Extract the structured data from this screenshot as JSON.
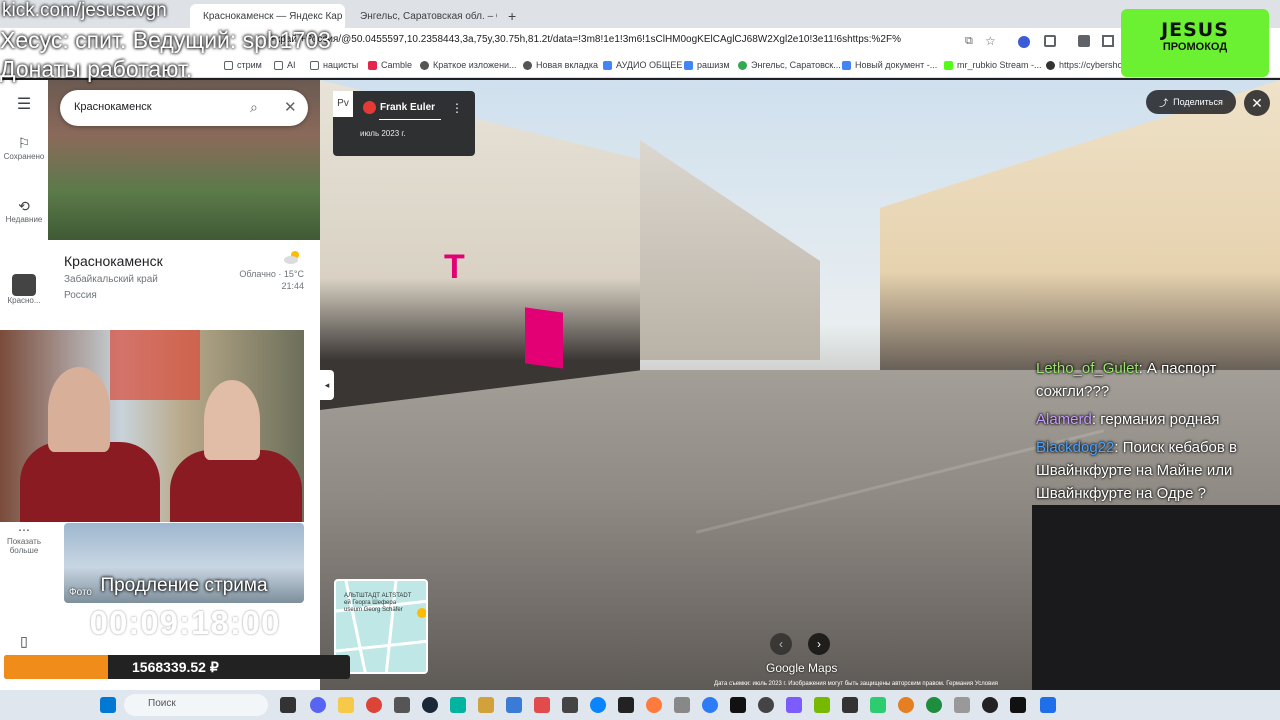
{
  "overlay": {
    "kick": "kick.com/jesusavgn",
    "host": "Хесус: спит. Ведущий: spb1703",
    "donations": "Донаты работают.",
    "promo_title": "JESUS",
    "promo_subtitle": "ПРОМОКОД",
    "extend_stream": "Продление стрима",
    "timer": "00:09:18:00",
    "donation_total": "1568339.52 ₽",
    "donation_progress": 0.3
  },
  "browser": {
    "tabs": [
      {
        "title": "Краснокаменск — Яндекс Кар",
        "color": "#ff3333"
      },
      {
        "title": "Энгельс, Саратовская обл. – G",
        "color": "#34a853"
      }
    ],
    "url": "+край,+Россия/@50.0455597,10.2358443,3a,75y,30.75h,81.2t/data=!3m8!1e1!3m6!1sClHM0ogKElCAglCJ68W2Xgl2e10!3e11!6shttps:%2F%",
    "bookmarks": [
      "стрим",
      "AI",
      "нацисты",
      "Camble",
      "Краткое изложени...",
      "Новая вкладка",
      "АУДИО ОБЩЕЕ",
      "рашизм",
      "Энгельс, Саратовск...",
      "Новый документ -...",
      "mr_rubkio Stream -...",
      "https://cybersho"
    ]
  },
  "maps": {
    "search_value": "Краснокаменск",
    "rail": {
      "saved": "Сохранено",
      "recent": "Недавние",
      "recent_place": "Красно...",
      "show_more": "Показать больше"
    },
    "place": {
      "name": "Краснокаменск",
      "region": "Забайкальский край",
      "country": "Россия",
      "weather": "Облачно · 15°C",
      "time": "21:44"
    },
    "photo_tag": "Фото"
  },
  "streetview": {
    "rv_label": "Рv",
    "author": "Frank Euler",
    "date": "июль 2023 г.",
    "share": "Поделиться",
    "minimap_label": "АЛЬТШТАДТ ALTSTADT\nей Георга Шефера\nuseum Georg Schäfer",
    "brand": "Google Maps",
    "legal": "Дата съемки: июль 2023 г.   Изображения могут быть защищены авторским правом.   Германия   Условия"
  },
  "chat": [
    {
      "user": "Letho_of_Gulet",
      "color": "#9be36e",
      "text": ": А паспорт сожгли???"
    },
    {
      "user": "Alamerd",
      "color": "#c79bff",
      "text": ": германия родная"
    },
    {
      "user": "Blackdog22",
      "color": "#4aa3ff",
      "text": ": Поиск кебабов в Швайнкфурте на Майне или Швайнкфурте на Одре ?"
    }
  ],
  "taskbar": {
    "search_placeholder": "Поиск"
  },
  "colors": {
    "accent_magenta": "#e20074",
    "donation_orange": "#f08c1a",
    "promo_green": "#6cf032"
  }
}
